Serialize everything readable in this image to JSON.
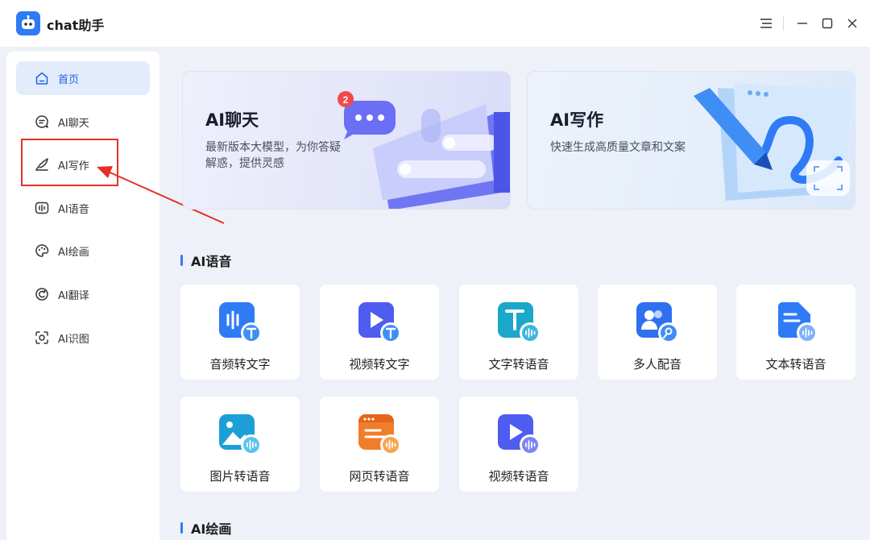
{
  "app": {
    "title": "chat助手"
  },
  "window_controls": {
    "menu_icon": "menu-icon",
    "minimize_icon": "minimize-icon",
    "maximize_icon": "maximize-icon",
    "close_icon": "close-icon"
  },
  "sidebar": {
    "items": [
      {
        "label": "首页",
        "icon": "home-icon",
        "active": true
      },
      {
        "label": "AI聊天",
        "icon": "chat-icon",
        "active": false
      },
      {
        "label": "AI写作",
        "icon": "feather-icon",
        "active": false
      },
      {
        "label": "AI语音",
        "icon": "voice-icon",
        "active": false
      },
      {
        "label": "AI绘画",
        "icon": "palette-icon",
        "active": false
      },
      {
        "label": "AI翻译",
        "icon": "translate-icon",
        "active": false
      },
      {
        "label": "AI识图",
        "icon": "scan-icon",
        "active": false
      }
    ]
  },
  "banners": [
    {
      "title": "AI聊天",
      "desc": "最新版本大模型，为你答疑解惑，提供灵感",
      "badge": "2"
    },
    {
      "title": "AI写作",
      "desc": "快速生成高质量文章和文案"
    }
  ],
  "sections": {
    "voice": {
      "title": "AI语音",
      "tools": [
        {
          "label": "音频转文字",
          "icon": "audio-to-text-icon"
        },
        {
          "label": "视频转文字",
          "icon": "video-to-text-icon"
        },
        {
          "label": "文字转语音",
          "icon": "text-to-speech-icon"
        },
        {
          "label": "多人配音",
          "icon": "multi-dubbing-icon"
        },
        {
          "label": "文本转语音",
          "icon": "document-to-speech-icon"
        },
        {
          "label": "图片转语音",
          "icon": "image-to-speech-icon"
        },
        {
          "label": "网页转语音",
          "icon": "webpage-to-speech-icon"
        },
        {
          "label": "视频转语音",
          "icon": "video-to-speech-icon"
        }
      ]
    },
    "drawing": {
      "title": "AI绘画"
    }
  },
  "colors": {
    "accent": "#2f7bf6",
    "active_bg": "#e3ecfb",
    "annotation": "#e4312a"
  }
}
